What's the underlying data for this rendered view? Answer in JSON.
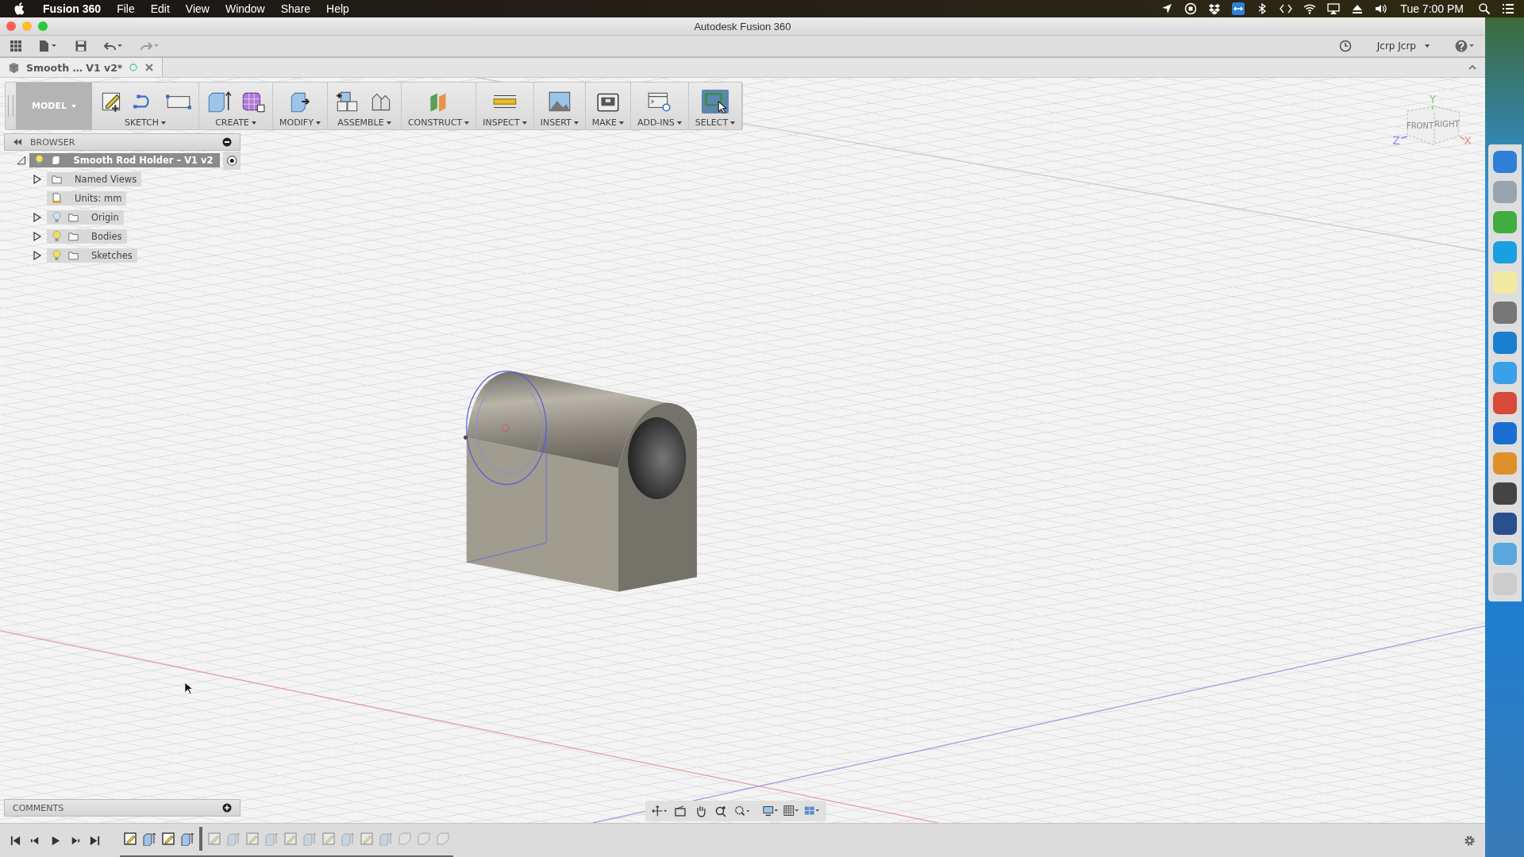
{
  "menu_bar": {
    "app_name": "Fusion 360",
    "items": [
      "File",
      "Edit",
      "View",
      "Window",
      "Share",
      "Help"
    ],
    "clock": "Tue 7:00 PM"
  },
  "window": {
    "title": "Autodesk Fusion 360"
  },
  "app_toolbar": {
    "user": "Jcrp Jcrp"
  },
  "document_tabs": [
    {
      "label": "Smooth … V1 v2*",
      "selected": true
    }
  ],
  "ribbon": {
    "workspace": "MODEL",
    "groups": [
      {
        "label": "SKETCH",
        "selected": false,
        "tools": [
          {
            "kind": "sketch"
          },
          {
            "kind": "arc"
          },
          {
            "kind": "rectangle"
          }
        ]
      },
      {
        "label": "CREATE",
        "selected": false,
        "tools": [
          {
            "kind": "extrude"
          },
          {
            "kind": "form"
          }
        ]
      },
      {
        "label": "MODIFY",
        "selected": false,
        "tools": [
          {
            "kind": "press-pull"
          }
        ]
      },
      {
        "label": "ASSEMBLE",
        "selected": false,
        "tools": [
          {
            "kind": "component"
          },
          {
            "kind": "joint"
          }
        ]
      },
      {
        "label": "CONSTRUCT",
        "selected": false,
        "tools": [
          {
            "kind": "plane"
          }
        ]
      },
      {
        "label": "INSPECT",
        "selected": false,
        "tools": [
          {
            "kind": "measure"
          }
        ]
      },
      {
        "label": "INSERT",
        "selected": false,
        "tools": [
          {
            "kind": "image"
          }
        ]
      },
      {
        "label": "MAKE",
        "selected": false,
        "tools": [
          {
            "kind": "print"
          }
        ]
      },
      {
        "label": "ADD-INS",
        "selected": false,
        "tools": [
          {
            "kind": "scripts"
          }
        ]
      },
      {
        "label": "SELECT",
        "selected": true,
        "tools": [
          {
            "kind": "select"
          }
        ]
      }
    ]
  },
  "browser": {
    "title": "BROWSER",
    "root": {
      "label": "Smooth Rod Holder – V1 v2",
      "expanded": true,
      "selected": true,
      "visible": true,
      "children": [
        {
          "label": "Named Views",
          "kind": "folder",
          "expanded": false,
          "selected": false
        },
        {
          "label": "Units: mm",
          "kind": "units",
          "selected": false
        },
        {
          "label": "Origin",
          "kind": "folder",
          "expanded": false,
          "selected": false,
          "visible": false
        },
        {
          "label": "Bodies",
          "kind": "folder",
          "expanded": false,
          "selected": false,
          "visible": true
        },
        {
          "label": "Sketches",
          "kind": "folder",
          "expanded": false,
          "selected": false,
          "visible": true
        }
      ]
    }
  },
  "view_cube": {
    "faces": [
      "FRONT",
      "RIGHT"
    ],
    "axes": [
      "X",
      "Y",
      "Z"
    ]
  },
  "comments": {
    "title": "COMMENTS"
  },
  "timeline": {
    "features": [
      {
        "kind": "sketch",
        "rolled_back": false
      },
      {
        "kind": "extrude",
        "rolled_back": false
      },
      {
        "kind": "sketch",
        "rolled_back": false
      },
      {
        "kind": "extrude",
        "rolled_back": false
      },
      {
        "kind": "sketch",
        "rolled_back": true
      },
      {
        "kind": "extrude",
        "rolled_back": true
      },
      {
        "kind": "sketch",
        "rolled_back": true
      },
      {
        "kind": "extrude",
        "rolled_back": true
      },
      {
        "kind": "sketch",
        "rolled_back": true
      },
      {
        "kind": "extrude",
        "rolled_back": true
      },
      {
        "kind": "sketch",
        "rolled_back": true
      },
      {
        "kind": "extrude",
        "rolled_back": true
      },
      {
        "kind": "sketch",
        "rolled_back": true
      },
      {
        "kind": "extrude",
        "rolled_back": true
      },
      {
        "kind": "fillet",
        "rolled_back": true
      },
      {
        "kind": "fillet",
        "rolled_back": true
      },
      {
        "kind": "fillet",
        "rolled_back": true
      }
    ]
  }
}
